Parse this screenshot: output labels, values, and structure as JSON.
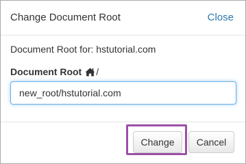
{
  "dialog": {
    "title": "Change Document Root",
    "close_label": "Close"
  },
  "root_info": {
    "text": "Document Root for: hstutorial.com"
  },
  "field": {
    "label": "Document Root",
    "icon": "home-icon",
    "slash": "/",
    "value": "new_root/hstutorial.com"
  },
  "buttons": {
    "change_label": "Change",
    "cancel_label": "Cancel"
  },
  "colors": {
    "link": "#2a7ab0",
    "highlight": "#9b4fa6",
    "focus_border": "#66afe9"
  }
}
